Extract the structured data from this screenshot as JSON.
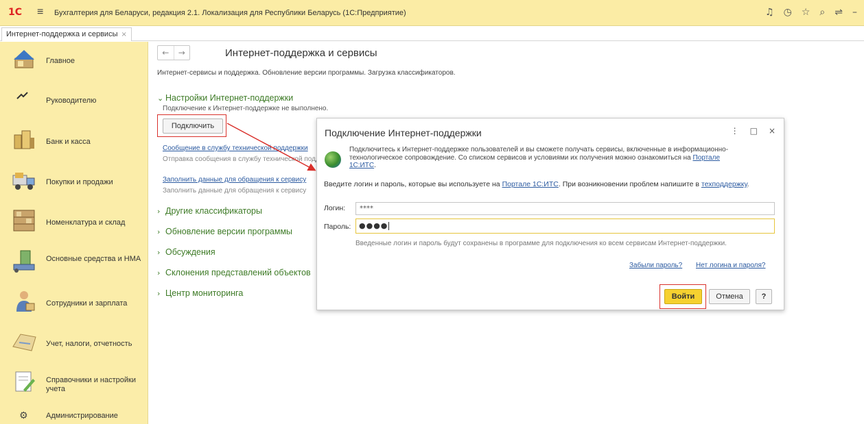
{
  "app": {
    "logo": "1С",
    "title": "Бухгалтерия для Беларуси, редакция 2.1. Локализация для Республики Беларусь  (1С:Предприятие)",
    "icons": [
      "bell-icon",
      "history-icon",
      "star-icon",
      "search-icon",
      "menu-icon",
      "minimize-icon"
    ]
  },
  "tabs": [
    {
      "label": "Интернет-поддержка и сервисы",
      "close": "×"
    }
  ],
  "sidebar": {
    "items": [
      {
        "label": "Главное",
        "icon": "home-icon"
      },
      {
        "label": "Руководителю",
        "icon": "trend-icon"
      },
      {
        "label": "Банк и касса",
        "icon": "bank-icon"
      },
      {
        "label": "Покупки и продажи",
        "icon": "truck-icon"
      },
      {
        "label": "Номенклатура и склад",
        "icon": "warehouse-icon"
      },
      {
        "label": "Основные средства и НМА",
        "icon": "assets-icon"
      },
      {
        "label": "Сотрудники и зарплата",
        "icon": "employee-icon"
      },
      {
        "label": "Учет, налоги, отчетность",
        "icon": "accounting-icon"
      },
      {
        "label": "Справочники и настройки учета",
        "icon": "settings-doc-icon"
      },
      {
        "label": "Администрирование",
        "icon": "gear-icon"
      }
    ]
  },
  "main": {
    "nav_back": "←",
    "nav_forward": "→",
    "title": "Интернет-поддержка и сервисы",
    "subtitle": "Интернет-сервисы и поддержка. Обновление версии программы. Загрузка классификаторов.",
    "settings_section": {
      "title": "Настройки Интернет-поддержки",
      "status": "Подключение к Интернет-поддержке не выполнено.",
      "connect_button": "Подключить",
      "support_link": "Сообщение в службу технической поддержки",
      "support_desc": "Отправка сообщения в службу технической поддержки",
      "fill_link": "Заполнить данные для обращения к сервису",
      "fill_desc": "Заполнить данные для обращения к сервису"
    },
    "sections": [
      {
        "title": "Другие классификаторы"
      },
      {
        "title": "Обновление версии программы"
      },
      {
        "title": "Обсуждения"
      },
      {
        "title": "Склонения представлений объектов"
      },
      {
        "title": "Центр мониторинга"
      }
    ]
  },
  "dialog": {
    "title": "Подключение Интернет-поддержки",
    "ctrl_more": "⋮",
    "ctrl_max": "□",
    "ctrl_close": "×",
    "intro_text": "Подключитесь к Интернет-поддержке пользователей и вы сможете получать сервисы, включенные в информационно-технологическое сопровождение. Со списком сервисов и условиями их получения можно ознакомиться на ",
    "intro_link": "Портале 1С:ИТС",
    "intro_end": ".",
    "login_text_1": "Введите логин и пароль, которые вы используете на ",
    "login_link": "Портале 1С:ИТС",
    "login_text_2": ". При возникновении проблем напишите в ",
    "support_link": "техподдержку",
    "login_text_3": ".",
    "login_label": "Логин:",
    "login_value": "****",
    "password_label": "Пароль:",
    "password_value": "●●●●",
    "hint": "Введенные логин и пароль будут сохранены в программе для подключения ко всем сервисам Интернет-поддержки.",
    "forgot_link": "Забыли пароль?",
    "no_login_link": "Нет логина и пароля?",
    "login_button": "Войти",
    "cancel_button": "Отмена",
    "help_button": "?"
  },
  "colors": {
    "titlebar": "#fbeca5",
    "sidebar": "#fbeda9",
    "section_green": "#3e7b27",
    "link_blue": "#2b5aa0",
    "primary_button": "#f6d130",
    "annotation_red": "#d9302b"
  }
}
